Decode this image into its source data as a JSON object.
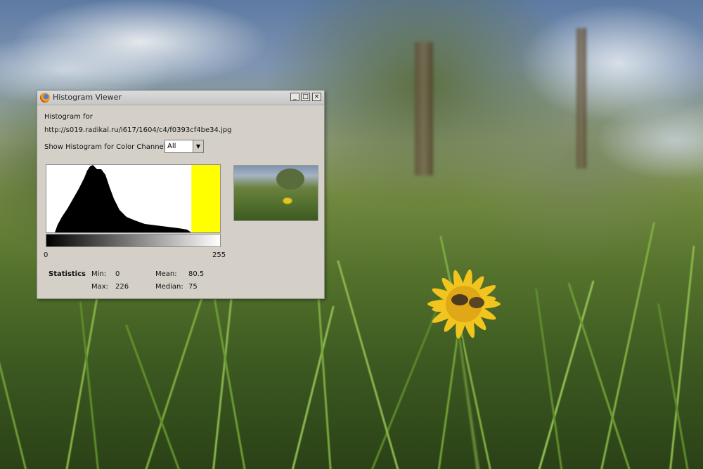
{
  "window": {
    "title": "Histogram Viewer",
    "controls": {
      "minimize": "_",
      "maximize": "□",
      "close": "×"
    }
  },
  "content": {
    "heading": "Histogram for",
    "url": "http://s019.radikal.ru/i617/1604/c4/f0393cf4be34.jpg",
    "channel_label": "Show Histogram for Color Channel:",
    "channel_value": "All"
  },
  "histogram": {
    "range_min": "0",
    "range_max": "255",
    "selection_range": [
      213,
      255
    ],
    "selection_color": "#ffff00"
  },
  "statistics": {
    "label": "Statistics",
    "min_label": "Min:",
    "min_value": "0",
    "max_label": "Max:",
    "max_value": "226",
    "mean_label": "Mean:",
    "mean_value": "80.5",
    "median_label": "Median:",
    "median_value": "75"
  },
  "icons": {
    "app": "browser-globe-icon",
    "channel_dropdown": "chevron-down-icon"
  }
}
